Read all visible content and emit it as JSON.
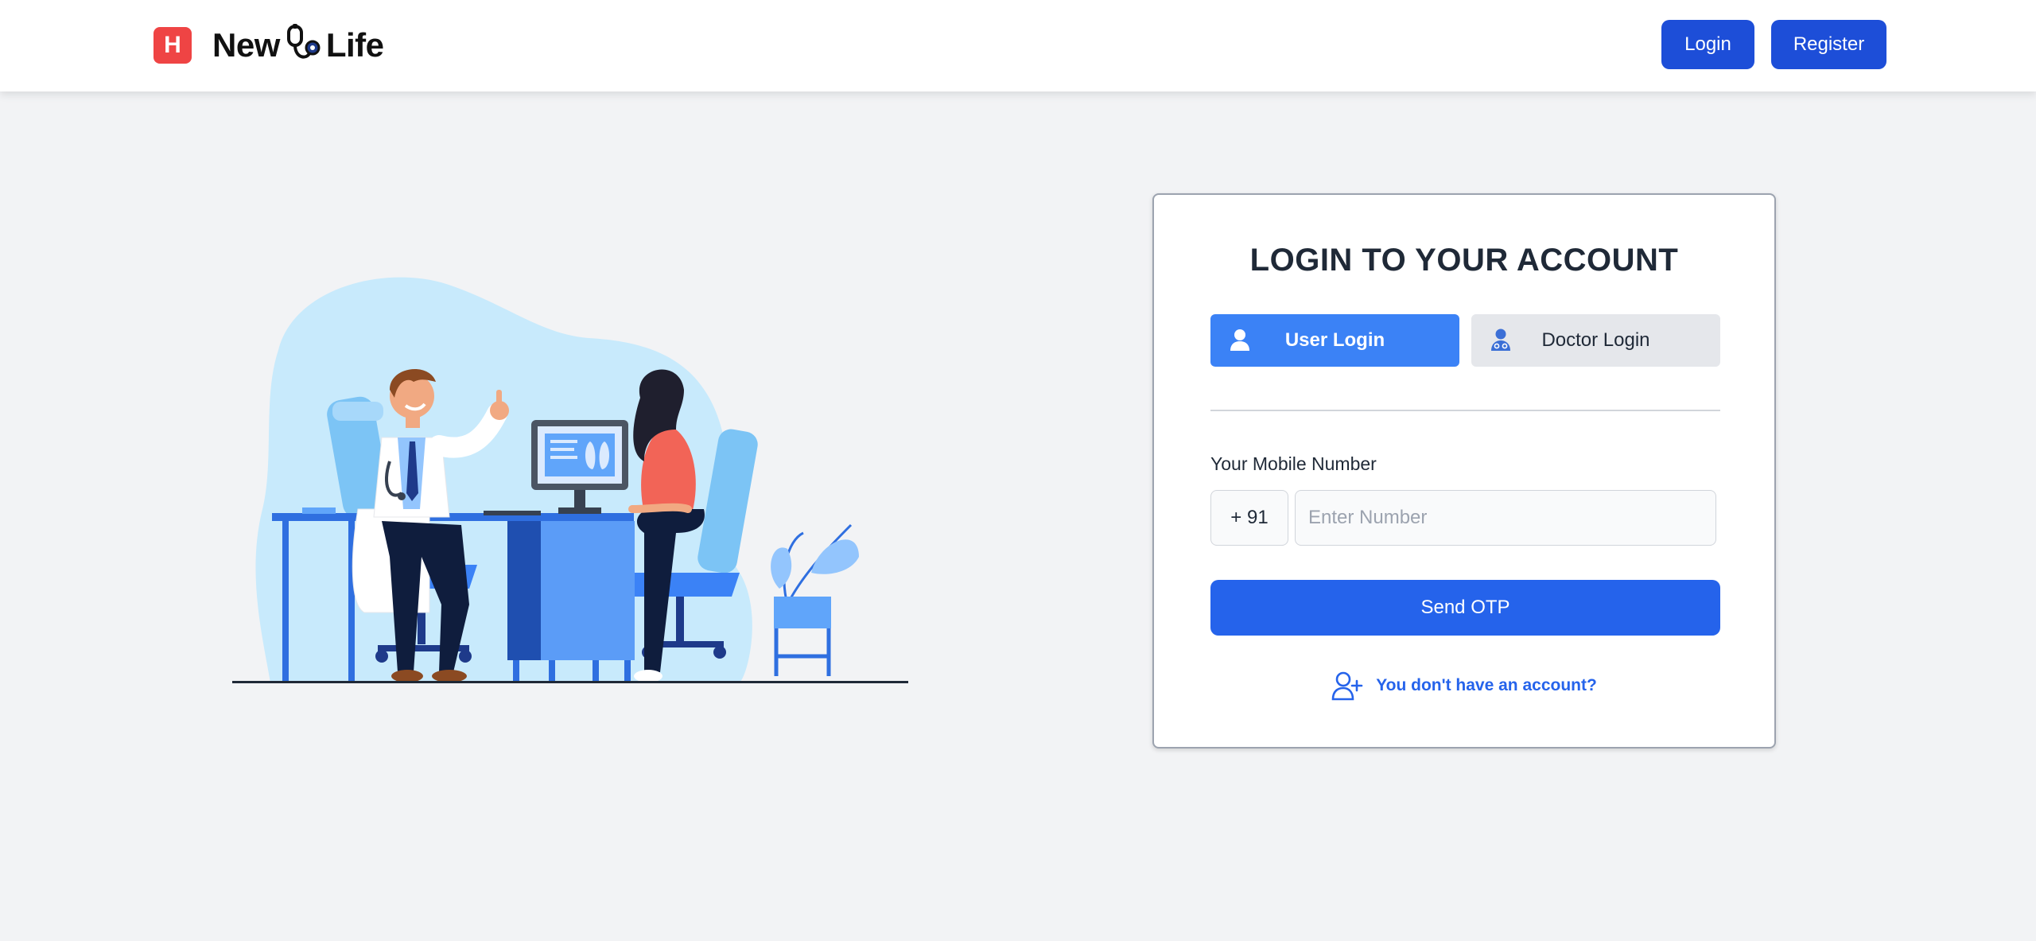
{
  "brand": {
    "logo_letter": "H",
    "name_part1": "New",
    "name_part2": "Life",
    "logo_icon": "stethoscope-icon"
  },
  "nav": {
    "login_label": "Login",
    "register_label": "Register"
  },
  "login_card": {
    "title": "LOGIN TO YOUR ACCOUNT",
    "tabs": [
      {
        "label": "User Login",
        "icon": "user-icon",
        "active": true
      },
      {
        "label": "Doctor Login",
        "icon": "doctor-icon",
        "active": false
      }
    ],
    "mobile_label": "Your Mobile Number",
    "country_code": "+ 91",
    "number_placeholder": "Enter Number",
    "number_value": "",
    "send_otp_label": "Send OTP",
    "signup_prompt": "You don't have an account?",
    "signup_icon": "add-user-icon"
  },
  "colors": {
    "primary": "#1d4ed8",
    "active_tab": "#3b82f6",
    "send_button": "#2563eb",
    "logo_red": "#ef4444",
    "page_bg": "#f2f3f5"
  }
}
